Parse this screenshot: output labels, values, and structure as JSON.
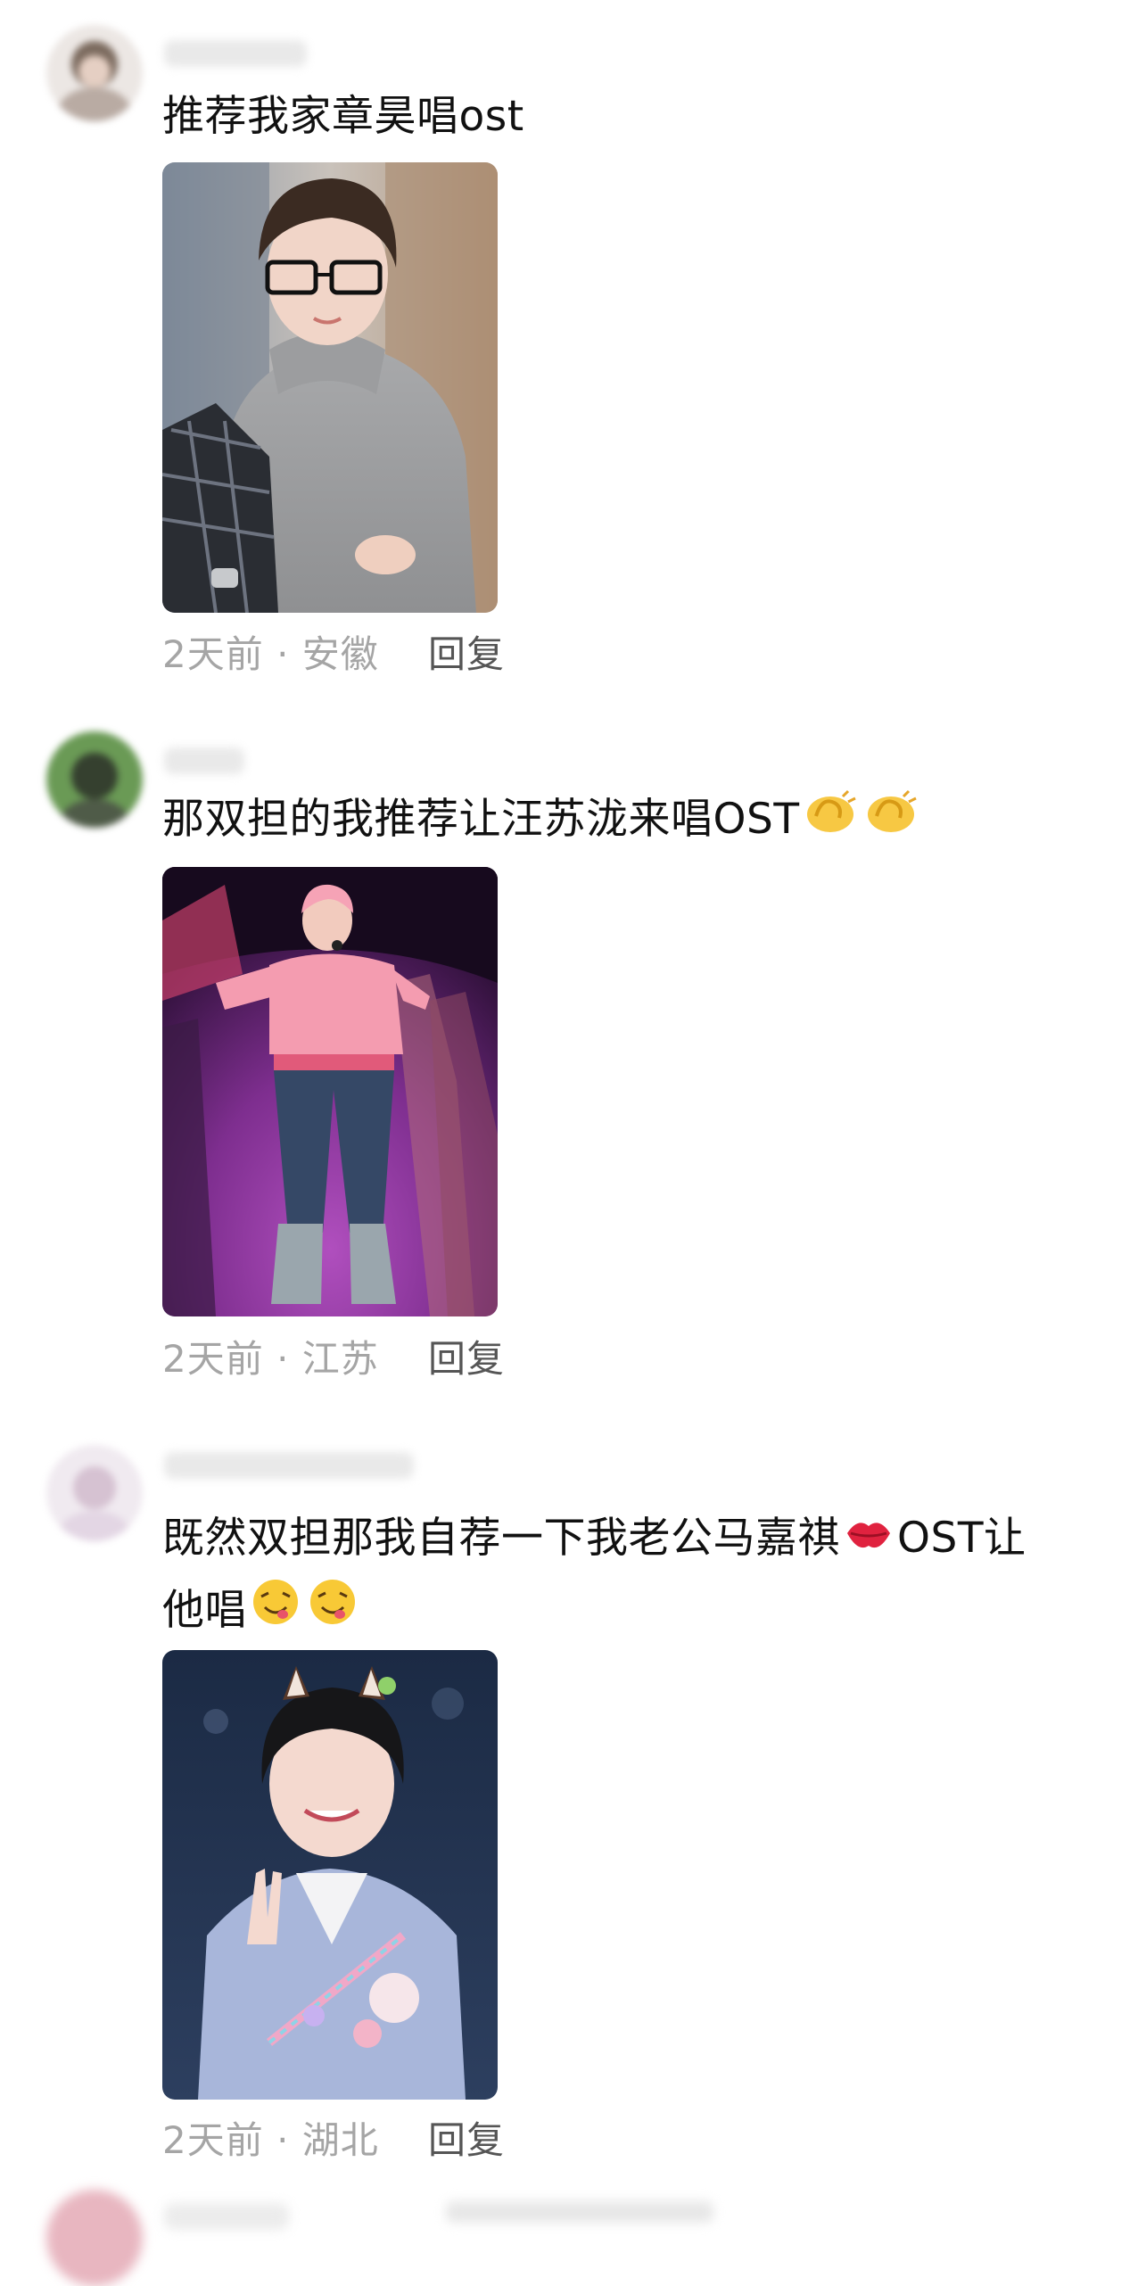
{
  "comments": [
    {
      "text": "推荐我家章昊唱ost",
      "emojis": [],
      "meta": "2天前 · 安徽",
      "reply": "回复",
      "avatar_color": "#8a7d73",
      "photo_theme": "grey-hoodie"
    },
    {
      "text": "那双担的我推荐让汪苏泷来唱OST",
      "emojis": [
        "clap-emoji",
        "clap-emoji"
      ],
      "meta": "2天前 · 江苏",
      "reply": "回复",
      "avatar_color": "#5e8c4a",
      "photo_theme": "pink-stage"
    },
    {
      "text_line1": "既然双担那我自荐一下我老公马嘉祺",
      "text_line1_after": "OST让",
      "text_line2": "他唱",
      "emojis": [
        "kiss-emoji",
        "yum-emoji",
        "yum-emoji"
      ],
      "meta": "2天前 · 湖北",
      "reply": "回复",
      "avatar_color": "#d9d0d8",
      "photo_theme": "cat-ears"
    }
  ],
  "colors": {
    "meta": "#a5a5a5",
    "reply": "#555555",
    "text": "#111111"
  }
}
